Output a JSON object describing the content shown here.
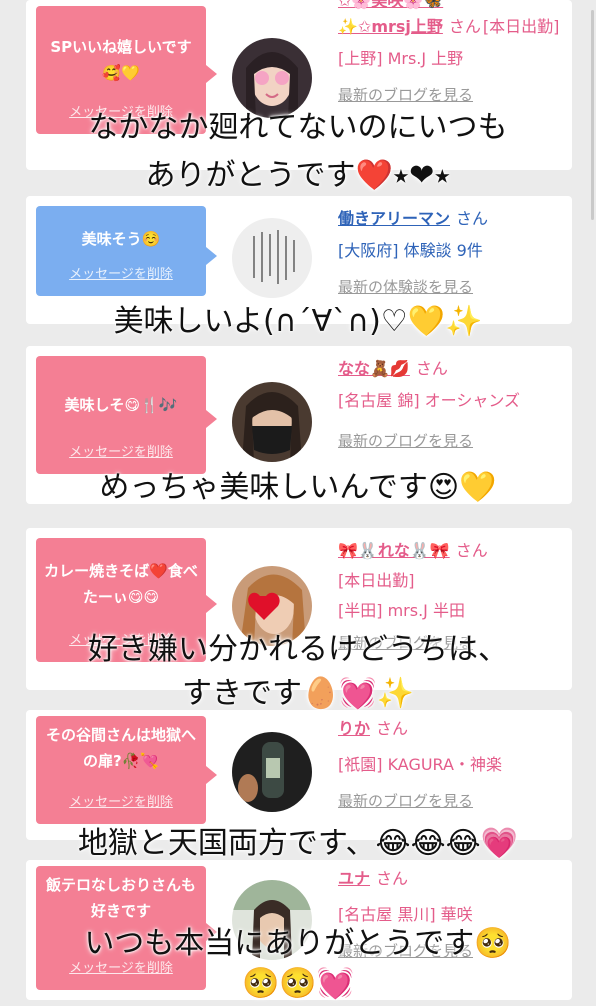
{
  "cards": [
    {
      "bubble": "SPいいね嬉しいです🥰💛",
      "delete": "メッセージを削除",
      "name_prefix": "✨✩mrsj上野",
      "name_top": "✩🌸美咲🌸🦋",
      "san": "さん",
      "status": "[本日出勤]",
      "shop": "[上野] Mrs.J 上野",
      "link": "最新のブログを見る"
    },
    {
      "bubble": "美味そう☺️",
      "delete": "メッセージを削除",
      "name": "働きアリーマン",
      "san": "さん",
      "shop": "[大阪府] 体験談 9件",
      "link": "最新の体験談を見る"
    },
    {
      "bubble": "美味しそ😋🍴🎶",
      "delete": "メッセージを削除",
      "name": "なな🧸💋",
      "san": "さん",
      "shop": "[名古屋 錦] オーシャンズ",
      "link": "最新のブログを見る"
    },
    {
      "bubble": "カレー焼きそば❤️食べたーぃ😋😋",
      "delete": "メッセージを削除",
      "name": "🎀🐰れな🐰🎀",
      "san": "さん",
      "status": "[本日出勤]",
      "shop": "[半田] mrs.J 半田",
      "link": "最新のブログを見る"
    },
    {
      "bubble": "その谷間さんは地獄への扉?🥀💘",
      "delete": "メッセージを削除",
      "name": "りか",
      "san": "さん",
      "shop": "[祇園] KAGURA・神楽",
      "link": "最新のブログを見る"
    },
    {
      "bubble": "飯テロなしおりさんも好きです",
      "delete": "メッセージを削除",
      "name": "ユナ",
      "san": "さん",
      "shop": "[名古屋 黒川] 華咲",
      "link": "最新のブログを見る"
    }
  ],
  "captions": {
    "c1a": "なかなか廻れてないのにいつも",
    "c1b": "ありがとうです❤️⭑❤⭑",
    "c2": "美味しいよ(∩´∀`∩)♡💛✨",
    "c3": "めっちゃ美味しいんです😍💛",
    "c4a": "好き嫌い分かれるけどうちは、",
    "c4b": "すきです🥚💓✨",
    "c5": "地獄と天国両方です、😂😂😂💗",
    "c6a": "いつも本当にありがとうです🥺",
    "c6b": "🥺🥺💓"
  }
}
